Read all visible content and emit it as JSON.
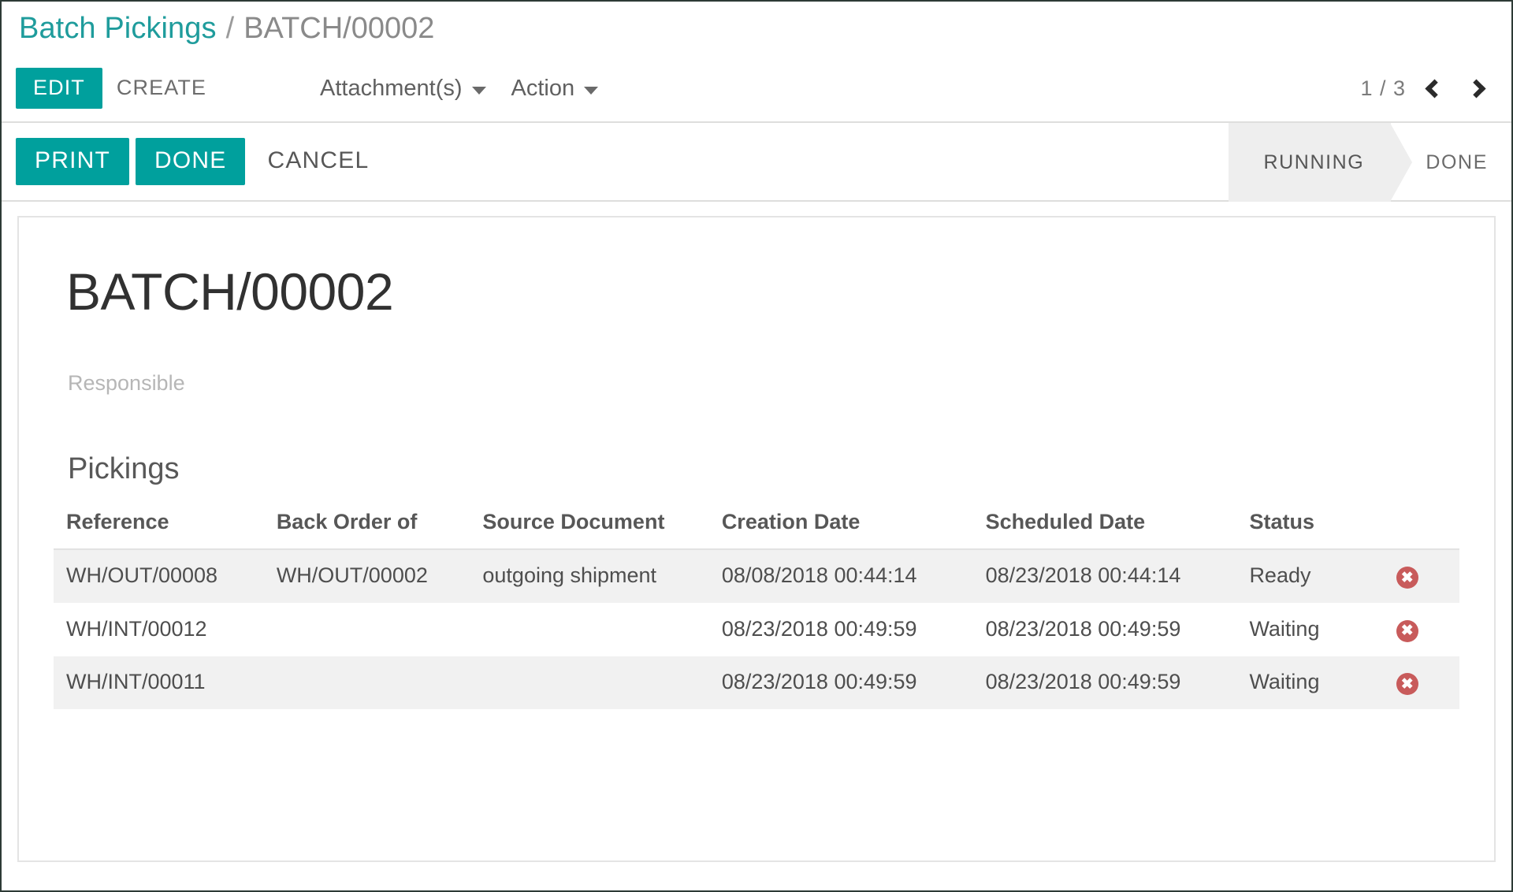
{
  "breadcrumb": {
    "root": "Batch Pickings",
    "separator": "/",
    "current": "BATCH/00002"
  },
  "control_panel": {
    "edit_label": "EDIT",
    "create_label": "CREATE",
    "attachments_label": "Attachment(s)",
    "action_label": "Action",
    "pager": "1 / 3",
    "prev_icon": "chevron-left-icon",
    "next_icon": "chevron-right-icon"
  },
  "statusbar_row": {
    "print_label": "PRINT",
    "done_label": "DONE",
    "cancel_label": "CANCEL",
    "stages": [
      {
        "label": "RUNNING",
        "active": true
      },
      {
        "label": "DONE",
        "active": false
      }
    ]
  },
  "record": {
    "title": "BATCH/00002",
    "responsible_label": "Responsible",
    "responsible_value": ""
  },
  "pickings": {
    "section_title": "Pickings",
    "columns": [
      "Reference",
      "Back Order of",
      "Source Document",
      "Creation Date",
      "Scheduled Date",
      "Status"
    ],
    "rows": [
      {
        "reference": "WH/OUT/00008",
        "back_order_of": "WH/OUT/00002",
        "source_document": "outgoing shipment",
        "creation_date": "08/08/2018 00:44:14",
        "scheduled_date": "08/23/2018 00:44:14",
        "status": "Ready",
        "delete_icon": "delete-circle-icon"
      },
      {
        "reference": "WH/INT/00012",
        "back_order_of": "",
        "source_document": "",
        "creation_date": "08/23/2018 00:49:59",
        "scheduled_date": "08/23/2018 00:49:59",
        "status": "Waiting",
        "delete_icon": "delete-circle-icon"
      },
      {
        "reference": "WH/INT/00011",
        "back_order_of": "",
        "source_document": "",
        "creation_date": "08/23/2018 00:49:59",
        "scheduled_date": "08/23/2018 00:49:59",
        "status": "Waiting",
        "delete_icon": "delete-circle-icon"
      }
    ],
    "delete_glyph": "✖"
  },
  "colors": {
    "primary": "#00a09d",
    "breadcrumb_link": "#1f9c9c",
    "delete": "#c85b5b",
    "stage_active_bg": "#eeeeee",
    "row_stripe": "#f1f1f1"
  }
}
